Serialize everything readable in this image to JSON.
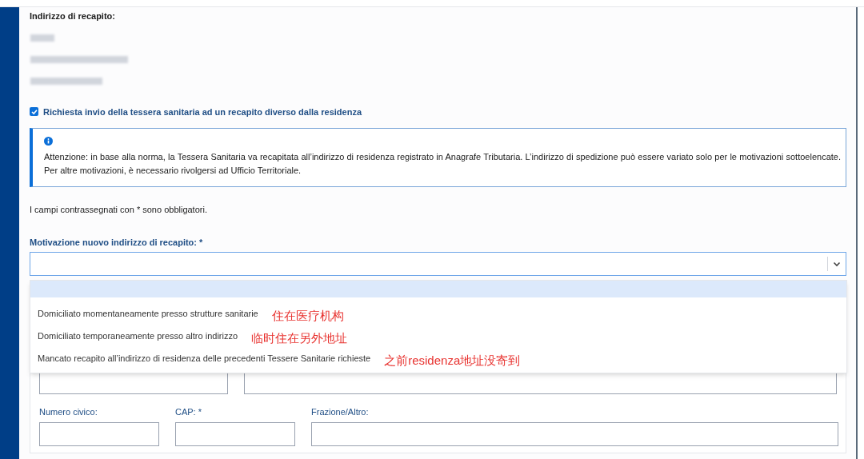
{
  "section_title": "Indirizzo di recapito:",
  "different_address_checkbox": {
    "label": "Richiesta invio della tessera sanitaria ad un recapito diverso dalla residenza",
    "checked": true
  },
  "notice": {
    "text": "Attenzione: in base alla norma, la Tessera Sanitaria va recapitata all’indirizzo di residenza registrato in Anagrafe Tributaria. L’indirizzo di spedizione può essere variato solo per le motivazioni sottoelencate. Per altre motivazioni, è necessario rivolgersi ad Ufficio Territoriale."
  },
  "required_note": "I campi contrassegnati con * sono obbligatori.",
  "reason_select": {
    "label": "Motivazione nuovo indirizzo di recapito: *",
    "expanded": true,
    "blank_option_highlighted": true,
    "options": [
      {
        "text": "Domiciliato momentaneamente presso strutture sanitarie",
        "selected": false,
        "note": "住在医疗机构"
      },
      {
        "text": "Domiciliato temporaneamente presso altro indirizzo",
        "selected": false,
        "note": "临时住在另外地址"
      },
      {
        "text": "Mancato recapito all’indirizzo di residenza delle precedenti Tessere Sanitarie richieste",
        "selected": false,
        "note": "之前residenza地址没寄到"
      }
    ]
  },
  "address_fields": [
    {
      "label": "Numero civico:"
    },
    {
      "label": "CAP: *"
    },
    {
      "label": "Frazione/Altro:"
    }
  ]
}
